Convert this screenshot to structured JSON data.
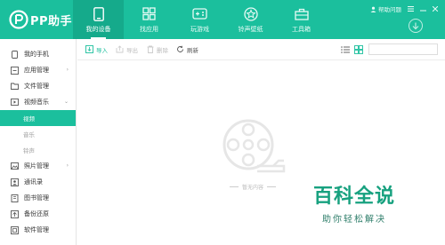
{
  "app": {
    "name": "PP助手"
  },
  "nav": {
    "items": [
      {
        "label": "我的设备",
        "icon": "phone-icon",
        "active": true
      },
      {
        "label": "找应用",
        "icon": "apps-icon"
      },
      {
        "label": "玩游戏",
        "icon": "gamepad-icon"
      },
      {
        "label": "铃声壁纸",
        "icon": "star-icon"
      },
      {
        "label": "工具箱",
        "icon": "toolbox-icon"
      }
    ]
  },
  "topright": {
    "feedback": "帮助问题"
  },
  "sidebar": {
    "items": [
      {
        "label": "我的手机",
        "icon": "phone-outline-icon"
      },
      {
        "label": "应用管理",
        "icon": "app-manage-icon"
      },
      {
        "label": "文件管理",
        "icon": "folder-icon"
      },
      {
        "label": "视频音乐",
        "icon": "video-icon"
      }
    ],
    "subitems": [
      {
        "label": "视频",
        "active": true
      },
      {
        "label": "音乐"
      },
      {
        "label": "铃声"
      }
    ],
    "more": [
      {
        "label": "照片管理",
        "icon": "photo-icon"
      },
      {
        "label": "通讯录",
        "icon": "contacts-icon"
      },
      {
        "label": "图书管理",
        "icon": "book-icon"
      },
      {
        "label": "备份还原",
        "icon": "backup-icon"
      },
      {
        "label": "软件管理",
        "icon": "software-icon"
      }
    ]
  },
  "toolbar": {
    "import": "导入",
    "export": "导出",
    "delete": "删除",
    "refresh": "刷新"
  },
  "main": {
    "empty": "暂无内容"
  },
  "watermark": {
    "main": "百科全说",
    "sub": "助你轻松解决"
  },
  "colors": {
    "brand": "#1bbf9d",
    "brand_dark": "#15aa8b"
  }
}
